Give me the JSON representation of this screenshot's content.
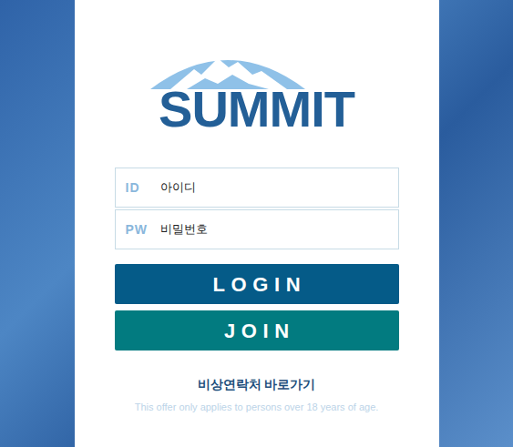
{
  "logo": {
    "text": "SUMMIT"
  },
  "fields": [
    {
      "label": "ID",
      "placeholder": "아이디",
      "kind": "text"
    },
    {
      "label": "PW",
      "placeholder": "비밀번호",
      "kind": "password"
    }
  ],
  "buttons": [
    {
      "label": "LOGIN",
      "color": "#055b88"
    },
    {
      "label": "JOIN",
      "color": "#027b80"
    }
  ],
  "link": "비상연락처 바로가기",
  "notice": "This offer only applies to persons over 18 years of age."
}
